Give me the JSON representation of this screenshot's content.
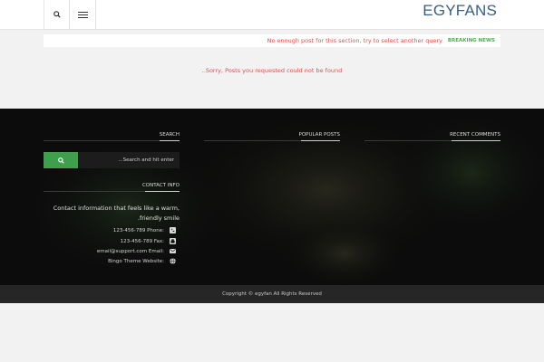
{
  "header": {
    "logo": "EGYFANS",
    "search_icon": "search-icon",
    "menu_icon": "hamburger-menu-icon"
  },
  "news_bar": {
    "message": "No enough post for this section, try to select another query",
    "label": "BREAKING NEWS"
  },
  "main": {
    "empty_message": "..Sorry, Posts you requested could not be found"
  },
  "footer": {
    "columns": [
      {
        "title": "SEARCH"
      },
      {
        "title": "POPULAR POSTS"
      },
      {
        "title": "RECENT COMMENTS"
      }
    ],
    "search": {
      "placeholder": "...Search and hit enter"
    },
    "contact": {
      "title": "CONTACT INFO",
      "description": "Contact information that feels like a warm, friendly smile.",
      "items": [
        {
          "label": "Phone:",
          "value": "123-456-789",
          "icon": "phone-icon"
        },
        {
          "label": "Fax:",
          "value": "123-456-789",
          "icon": "fax-icon"
        },
        {
          "label": "Email:",
          "value": "email@support.com",
          "icon": "email-icon"
        },
        {
          "label": "Website:",
          "value": "Bingo Theme",
          "icon": "globe-icon"
        }
      ]
    },
    "copyright": "Copyright © egyfan All Rights Reserved"
  },
  "colors": {
    "accent_green": "#3fa04b",
    "logo_blue": "#3a5f80",
    "alert_red": "#d9534f"
  }
}
